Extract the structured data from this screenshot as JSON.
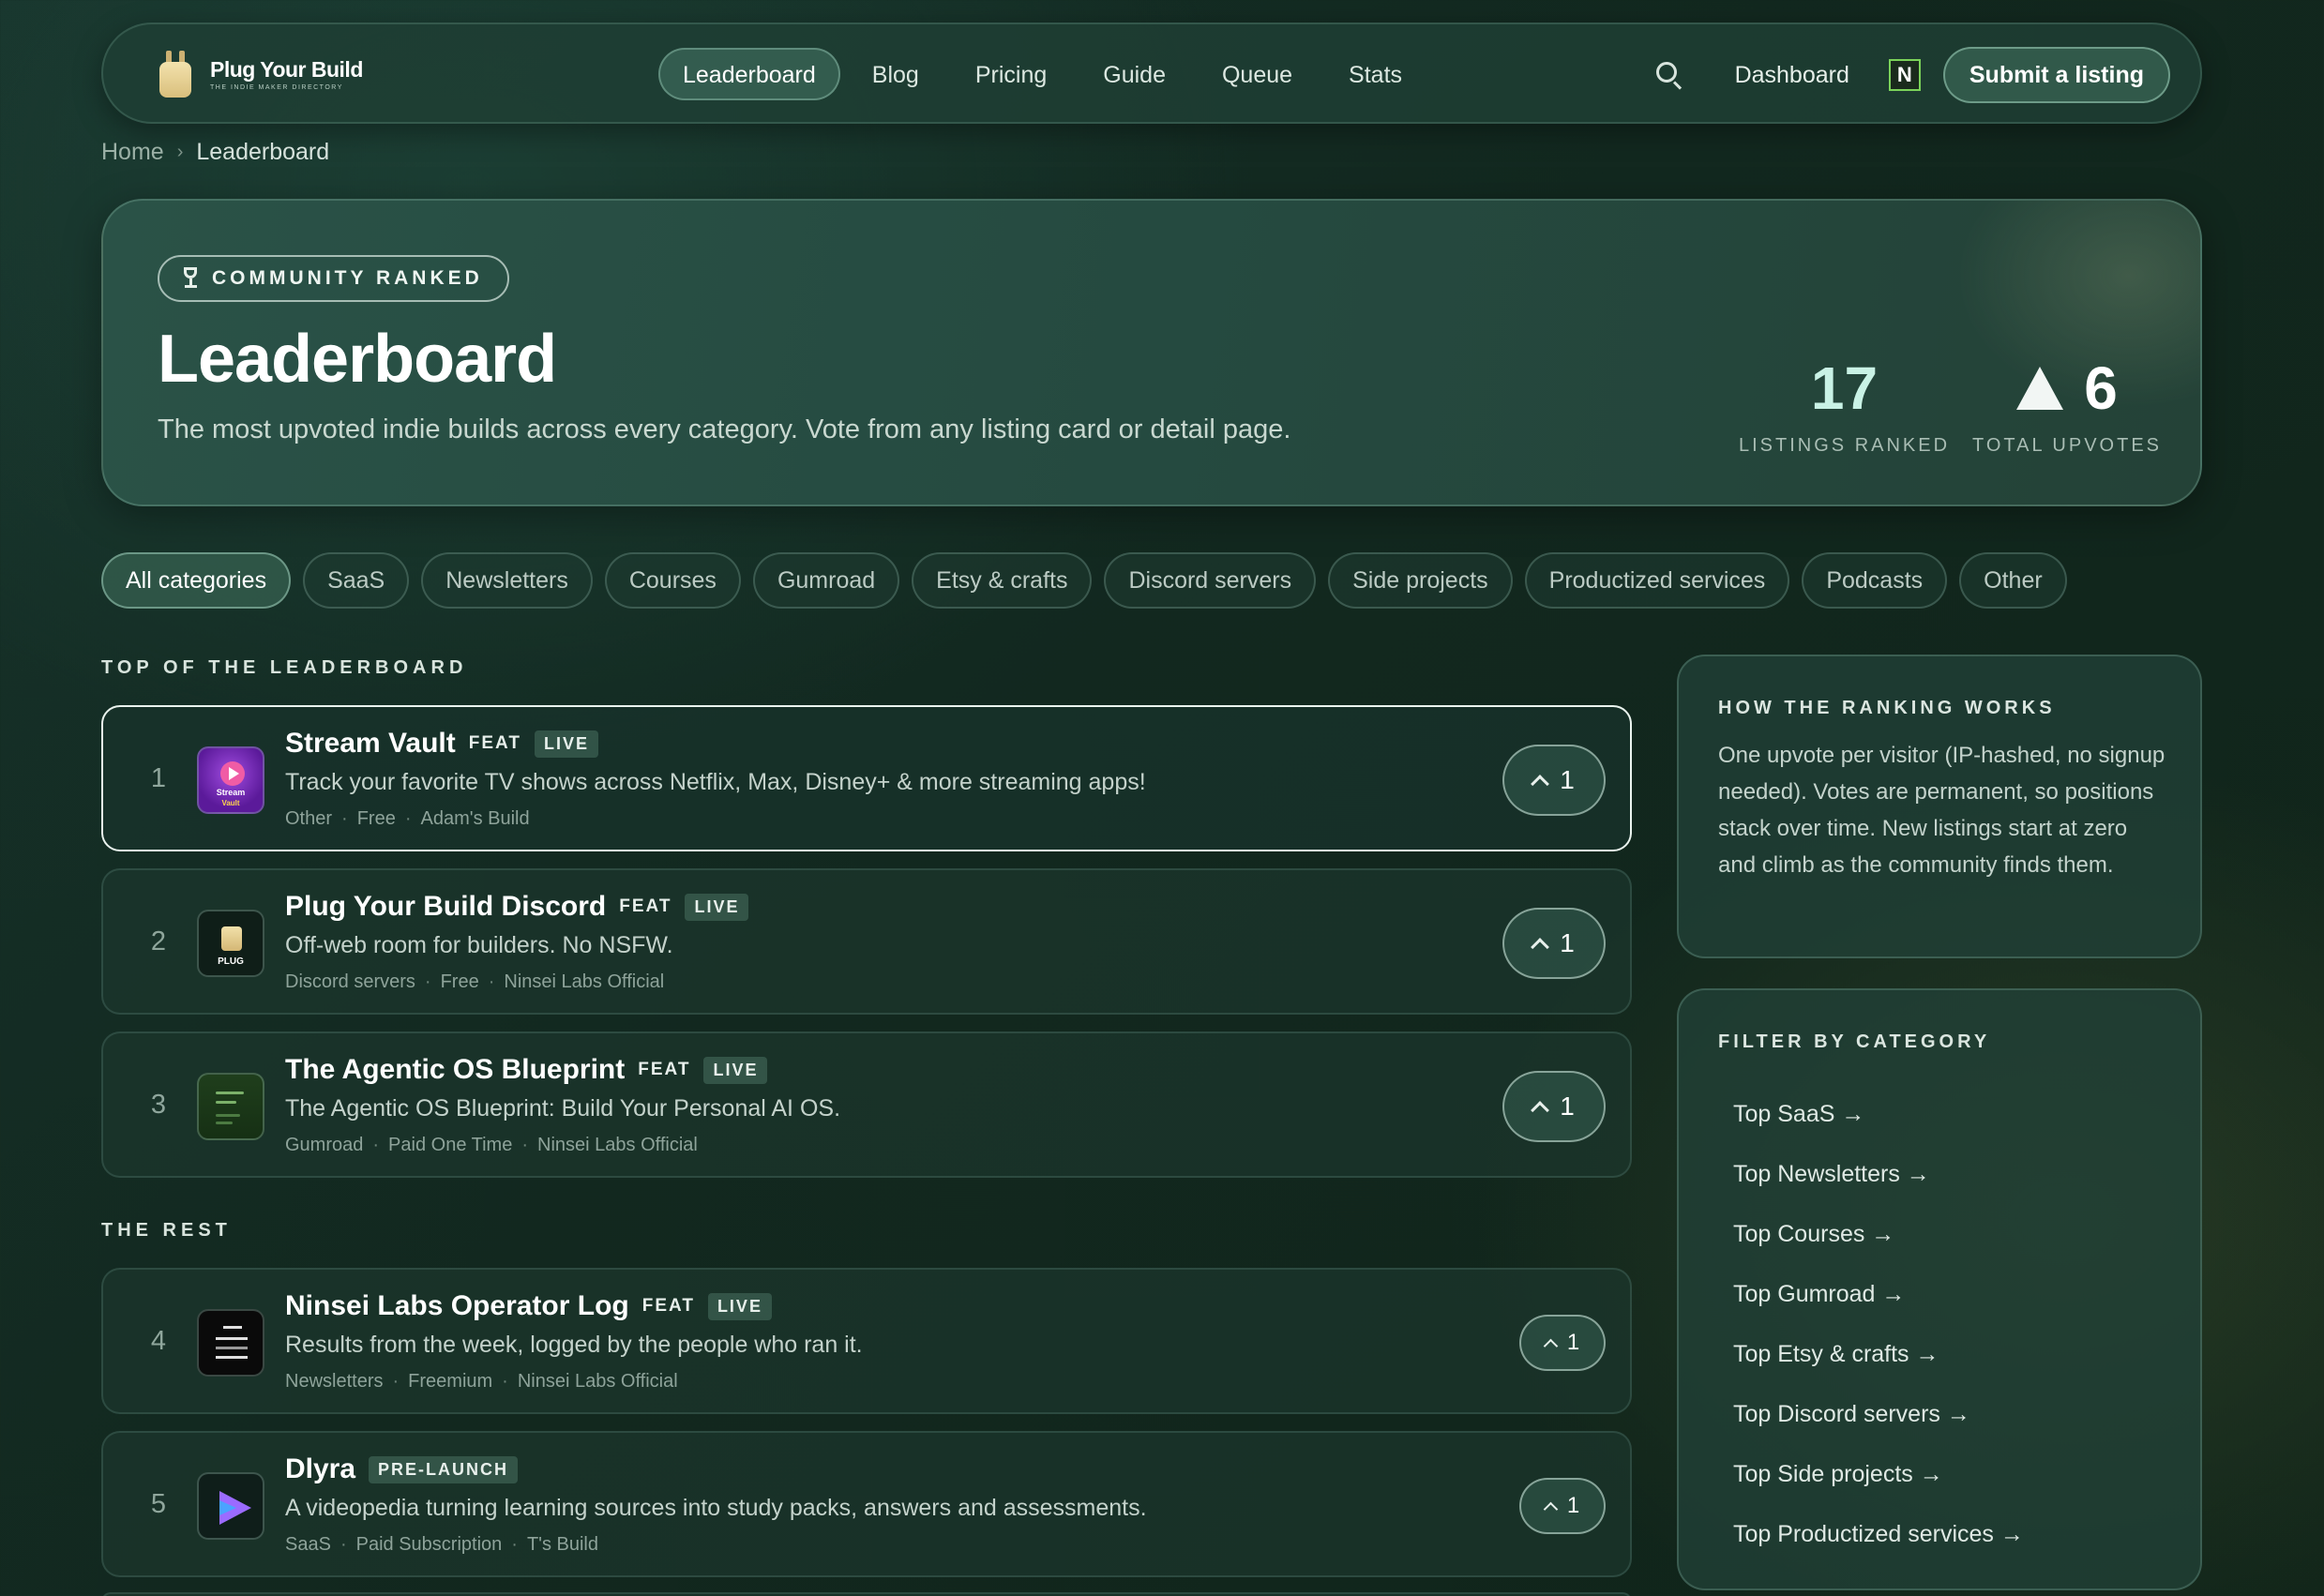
{
  "brand": {
    "name": "Plug Your Build",
    "tagline": "THE INDIE MAKER DIRECTORY"
  },
  "nav": {
    "links": [
      "Leaderboard",
      "Blog",
      "Pricing",
      "Guide",
      "Queue",
      "Stats"
    ],
    "active": "Leaderboard",
    "dashboard": "Dashboard",
    "n_badge": "N",
    "submit": "Submit a listing"
  },
  "breadcrumb": {
    "home": "Home",
    "sep": "›",
    "current": "Leaderboard"
  },
  "hero": {
    "pill": "COMMUNITY RANKED",
    "title": "Leaderboard",
    "subtitle": "The most upvoted indie builds across every category. Vote from any listing card or detail page.",
    "stats": [
      {
        "value": "17",
        "label": "LISTINGS RANKED"
      },
      {
        "value": "6",
        "label": "TOTAL UPVOTES"
      }
    ]
  },
  "categories": [
    "All categories",
    "SaaS",
    "Newsletters",
    "Courses",
    "Gumroad",
    "Etsy & crafts",
    "Discord servers",
    "Side projects",
    "Productized services",
    "Podcasts",
    "Other"
  ],
  "sections": {
    "top": "TOP OF THE LEADERBOARD",
    "rest": "THE REST"
  },
  "listings": [
    {
      "rank": "1",
      "title": "Stream Vault",
      "feat": "FEAT",
      "status": "LIVE",
      "desc": "Track your favorite TV shows across Netflix, Max, Disney+ & more streaming apps!",
      "category": "Other",
      "pricing": "Free",
      "maker": "Adam's Build",
      "votes": "1",
      "thumb_text": "Stream",
      "thumb_text2": "Vault"
    },
    {
      "rank": "2",
      "title": "Plug Your Build Discord",
      "feat": "FEAT",
      "status": "LIVE",
      "desc": "Off-web room for builders. No NSFW.",
      "category": "Discord servers",
      "pricing": "Free",
      "maker": "Ninsei Labs Official",
      "votes": "1",
      "thumb_text": "PLUG"
    },
    {
      "rank": "3",
      "title": "The Agentic OS Blueprint",
      "feat": "FEAT",
      "status": "LIVE",
      "desc": "The Agentic OS Blueprint: Build Your Personal AI OS.",
      "category": "Gumroad",
      "pricing": "Paid One Time",
      "maker": "Ninsei Labs Official",
      "votes": "1"
    },
    {
      "rank": "4",
      "title": "Ninsei Labs Operator Log",
      "feat": "FEAT",
      "status": "LIVE",
      "desc": "Results from the week, logged by the people who ran it.",
      "category": "Newsletters",
      "pricing": "Freemium",
      "maker": "Ninsei Labs Official",
      "votes": "1"
    },
    {
      "rank": "5",
      "title": "Dlyra",
      "status": "PRE-LAUNCH",
      "desc": "A videopedia turning learning sources into study packs, answers and assessments.",
      "category": "SaaS",
      "pricing": "Paid Subscription",
      "maker": "T's Build",
      "votes": "1"
    }
  ],
  "sidebar": {
    "ranking_title": "HOW THE RANKING WORKS",
    "ranking_body": "One upvote per visitor (IP-hashed, no signup needed). Votes are permanent, so positions stack over time. New listings start at zero and climb as the community finds them.",
    "filter_title": "FILTER BY CATEGORY",
    "filters": [
      "Top SaaS →",
      "Top Newsletters →",
      "Top Courses →",
      "Top Gumroad →",
      "Top Etsy & crafts →",
      "Top Discord servers →",
      "Top Side projects →",
      "Top Productized services →"
    ]
  },
  "colors": {
    "accent": "#c9f2e5",
    "live_badge_bg": "#3d6b5c",
    "n_badge_border": "#7bd35a"
  }
}
